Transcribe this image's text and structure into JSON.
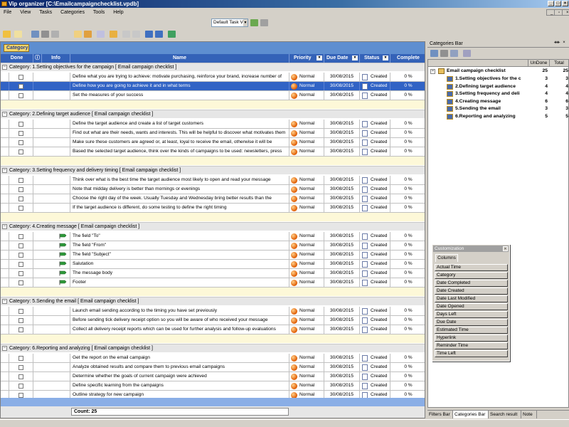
{
  "window": {
    "title": "Vip organizer [C:\\Emailcampaignchecklist.vpdb]"
  },
  "menu": [
    "File",
    "View",
    "Tasks",
    "Categories",
    "Tools",
    "Help"
  ],
  "taskview": {
    "value": "Default Task Vi"
  },
  "category_button": "Category",
  "columns": {
    "done": "Done",
    "info": "Info",
    "name": "Name",
    "priority": "Priority",
    "due": "Due Date",
    "status": "Status",
    "complete": "Complete"
  },
  "groups": [
    {
      "title": "Category: 1.Setting objectives for the campaign    [ Email campaign checklist ]",
      "rows": [
        {
          "name": "Define what you are trying to achieve: motivate purchasing, reinforce your brand, increase number of",
          "priority": "Normal",
          "due": "30/08/2015",
          "status": "Created",
          "complete": "0 %",
          "flag": false,
          "selected": false
        },
        {
          "name": "Define how you are going to achieve it and in what terms",
          "priority": "Normal",
          "due": "30/08/2015",
          "status": "Created",
          "complete": "0 %",
          "flag": false,
          "selected": true
        },
        {
          "name": "Set the measures of your success",
          "priority": "Normal",
          "due": "30/08/2015",
          "status": "Created",
          "complete": "0 %",
          "flag": false,
          "selected": false
        }
      ]
    },
    {
      "title": "Category: 2.Defining target audience    [ Email campaign checklist ]",
      "rows": [
        {
          "name": "Define the target audience and create a list of target customers",
          "priority": "Normal",
          "due": "30/08/2015",
          "status": "Created",
          "complete": "0 %",
          "flag": false,
          "selected": false
        },
        {
          "name": "Find out what are their needs, wants and interests. This will be helpful to discover what motivates them",
          "priority": "Normal",
          "due": "30/08/2015",
          "status": "Created",
          "complete": "0 %",
          "flag": false,
          "selected": false
        },
        {
          "name": "Make sure these customers are agreed or, at least, loyal to receive the email, otherwise it will be",
          "priority": "Normal",
          "due": "30/08/2015",
          "status": "Created",
          "complete": "0 %",
          "flag": false,
          "selected": false
        },
        {
          "name": "Based the selected target audience, think over the kinds of campaigns to be used: newsletters, press",
          "priority": "Normal",
          "due": "30/08/2015",
          "status": "Created",
          "complete": "0 %",
          "flag": false,
          "selected": false
        }
      ]
    },
    {
      "title": "Category: 3.Setting frequency and delivery timing    [ Email campaign checklist ]",
      "rows": [
        {
          "name": "Think over what is the best time the target audience most likely to open and read your message",
          "priority": "Normal",
          "due": "30/08/2015",
          "status": "Created",
          "complete": "0 %",
          "flag": false,
          "selected": false
        },
        {
          "name": "Note that midday delivery is better than mornings or evenings",
          "priority": "Normal",
          "due": "30/08/2015",
          "status": "Created",
          "complete": "0 %",
          "flag": false,
          "selected": false
        },
        {
          "name": "Choose the right day of the week. Usually Tuesday and Wednesday bring better results than the",
          "priority": "Normal",
          "due": "30/08/2015",
          "status": "Created",
          "complete": "0 %",
          "flag": false,
          "selected": false
        },
        {
          "name": "If the target audience is different, do some testing to define the right timing",
          "priority": "Normal",
          "due": "30/08/2015",
          "status": "Created",
          "complete": "0 %",
          "flag": false,
          "selected": false
        }
      ]
    },
    {
      "title": "Category: 4.Creating message    [ Email campaign checklist ]",
      "rows": [
        {
          "name": "The field \"To\"",
          "priority": "Normal",
          "due": "30/08/2015",
          "status": "Created",
          "complete": "0 %",
          "flag": true,
          "selected": false
        },
        {
          "name": "The field \"From\"",
          "priority": "Normal",
          "due": "30/08/2015",
          "status": "Created",
          "complete": "0 %",
          "flag": true,
          "selected": false
        },
        {
          "name": "The field \"Subject\"",
          "priority": "Normal",
          "due": "30/08/2015",
          "status": "Created",
          "complete": "0 %",
          "flag": true,
          "selected": false
        },
        {
          "name": "Salutation",
          "priority": "Normal",
          "due": "30/08/2015",
          "status": "Created",
          "complete": "0 %",
          "flag": true,
          "selected": false
        },
        {
          "name": "The message body",
          "priority": "Normal",
          "due": "30/08/2015",
          "status": "Created",
          "complete": "0 %",
          "flag": true,
          "selected": false
        },
        {
          "name": "Footer",
          "priority": "Normal",
          "due": "30/08/2015",
          "status": "Created",
          "complete": "0 %",
          "flag": true,
          "selected": false
        }
      ]
    },
    {
      "title": "Category: 5.Sending the email    [ Email campaign checklist ]",
      "rows": [
        {
          "name": "Launch email sending according to the timing you have set previously",
          "priority": "Normal",
          "due": "30/08/2015",
          "status": "Created",
          "complete": "0 %",
          "flag": false,
          "selected": false
        },
        {
          "name": "Before sending tick delivery receipt option so you will be aware of who received your message",
          "priority": "Normal",
          "due": "30/08/2015",
          "status": "Created",
          "complete": "0 %",
          "flag": false,
          "selected": false
        },
        {
          "name": "Collect all delivery receipt reports which can be used for further analysis and follow-up evaluations",
          "priority": "Normal",
          "due": "30/08/2015",
          "status": "Created",
          "complete": "0 %",
          "flag": false,
          "selected": false
        }
      ]
    },
    {
      "title": "Category: 6.Reporting and analyzing    [ Email campaign checklist ]",
      "rows": [
        {
          "name": "Get the report on the email campaign",
          "priority": "Normal",
          "due": "30/08/2015",
          "status": "Created",
          "complete": "0 %",
          "flag": false,
          "selected": false
        },
        {
          "name": "Analyze obtained results and compare them to previous email campaigns",
          "priority": "Normal",
          "due": "30/08/2015",
          "status": "Created",
          "complete": "0 %",
          "flag": false,
          "selected": false
        },
        {
          "name": "Determine whether the goals of current campaign were achieved",
          "priority": "Normal",
          "due": "30/08/2015",
          "status": "Created",
          "complete": "0 %",
          "flag": false,
          "selected": false
        },
        {
          "name": "Define specific learning from the campaigns",
          "priority": "Normal",
          "due": "30/08/2015",
          "status": "Created",
          "complete": "0 %",
          "flag": false,
          "selected": false
        },
        {
          "name": "Outline strategy for new campaign",
          "priority": "Normal",
          "due": "30/08/2015",
          "status": "Created",
          "complete": "0 %",
          "flag": false,
          "selected": false
        }
      ]
    }
  ],
  "count": "Count:  25",
  "categories_bar": {
    "title": "Categories Bar",
    "col_undone": "UnDone",
    "col_total": "Total",
    "root": {
      "label": "Email campaign checklist",
      "undone": "25",
      "total": "25"
    },
    "children": [
      {
        "label": "1.Setting objectives for the c",
        "undone": "3",
        "total": "3"
      },
      {
        "label": "2.Defining target audience",
        "undone": "4",
        "total": "4"
      },
      {
        "label": "3.Setting frequency and deli",
        "undone": "4",
        "total": "4"
      },
      {
        "label": "4.Creating message",
        "undone": "6",
        "total": "6"
      },
      {
        "label": "5.Sending the email",
        "undone": "3",
        "total": "3"
      },
      {
        "label": "6.Reporting and analyzing",
        "undone": "5",
        "total": "5"
      }
    ]
  },
  "customization": {
    "title": "Customization",
    "tab": "Columns",
    "items": [
      "Actual Time",
      "Category",
      "Date Completed",
      "Date Created",
      "Date Last Modified",
      "Date Opened",
      "Days Left",
      "Due Date",
      "Estimated Time",
      "Hyperlink",
      "Reminder Time",
      "Time Left"
    ]
  },
  "bottom_tabs": [
    "Filters Bar",
    "Categories Bar",
    "Search result",
    "Note"
  ],
  "colors": {
    "header_blue": "#3462b8",
    "selection": "#3163c5",
    "category_yellow": "#fad86a",
    "spacer": "#fdf8d8"
  }
}
